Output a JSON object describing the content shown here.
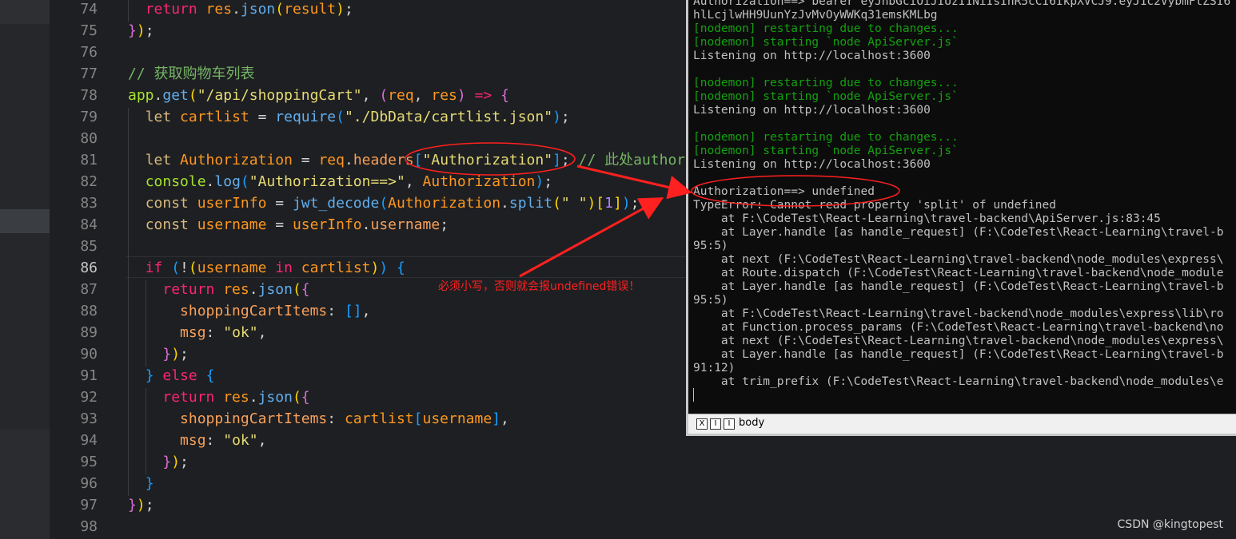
{
  "editor": {
    "line_numbers": [
      "74",
      "75",
      "76",
      "77",
      "78",
      "79",
      "80",
      "81",
      "82",
      "83",
      "84",
      "85",
      "86",
      "87",
      "88",
      "89",
      "90",
      "91",
      "92",
      "93",
      "94",
      "95",
      "96",
      "97",
      "98"
    ],
    "current_line": "86",
    "lines": [
      [
        [
          "plain",
          "  "
        ],
        [
          "kw",
          "return "
        ],
        [
          "var",
          "res"
        ],
        [
          "plain",
          "."
        ],
        [
          "meth",
          "json"
        ],
        [
          "br1",
          "("
        ],
        [
          "var",
          "result"
        ],
        [
          "br1",
          ")"
        ],
        [
          "plain",
          ";"
        ]
      ],
      [
        [
          "br2",
          "}"
        ],
        [
          "br1",
          ")"
        ],
        [
          "plain",
          ";"
        ]
      ],
      [],
      [
        [
          "cm",
          "// 获取购物车列表"
        ]
      ],
      [
        [
          "fn",
          "app"
        ],
        [
          "plain",
          "."
        ],
        [
          "meth",
          "get"
        ],
        [
          "br1",
          "("
        ],
        [
          "str",
          "\"/api/shoppingCart\""
        ],
        [
          "plain",
          ", "
        ],
        [
          "br2",
          "("
        ],
        [
          "var",
          "req"
        ],
        [
          "plain",
          ", "
        ],
        [
          "var",
          "res"
        ],
        [
          "br2",
          ")"
        ],
        [
          "plain",
          " "
        ],
        [
          "kw",
          "=>"
        ],
        [
          "plain",
          " "
        ],
        [
          "br2",
          "{"
        ]
      ],
      [
        [
          "plain",
          "  "
        ],
        [
          "kw2",
          "let "
        ],
        [
          "var",
          "cartlist"
        ],
        [
          "plain",
          " = "
        ],
        [
          "meth",
          "require"
        ],
        [
          "br3",
          "("
        ],
        [
          "str",
          "\"./DbData/cartlist.json\""
        ],
        [
          "br3",
          ")"
        ],
        [
          "plain",
          ";"
        ]
      ],
      [],
      [
        [
          "plain",
          "  "
        ],
        [
          "kw2",
          "let "
        ],
        [
          "var",
          "Authorization"
        ],
        [
          "plain",
          " = "
        ],
        [
          "var",
          "req"
        ],
        [
          "plain",
          "."
        ],
        [
          "prop",
          "headers"
        ],
        [
          "br3",
          "["
        ],
        [
          "str",
          "\"Authorization\""
        ],
        [
          "br3",
          "]"
        ],
        [
          "plain",
          "; "
        ],
        [
          "cm",
          "// 此处author"
        ]
      ],
      [
        [
          "plain",
          "  "
        ],
        [
          "fn",
          "console"
        ],
        [
          "plain",
          "."
        ],
        [
          "meth",
          "log"
        ],
        [
          "br3",
          "("
        ],
        [
          "str",
          "\"Authorization==>\""
        ],
        [
          "plain",
          ", "
        ],
        [
          "var",
          "Authorization"
        ],
        [
          "br3",
          ")"
        ],
        [
          "plain",
          ";"
        ]
      ],
      [
        [
          "plain",
          "  "
        ],
        [
          "kw2",
          "const "
        ],
        [
          "var",
          "userInfo"
        ],
        [
          "plain",
          " = "
        ],
        [
          "meth",
          "jwt_decode"
        ],
        [
          "br3",
          "("
        ],
        [
          "var",
          "Authorization"
        ],
        [
          "plain",
          "."
        ],
        [
          "meth",
          "split"
        ],
        [
          "br1",
          "("
        ],
        [
          "str",
          "\" \""
        ],
        [
          "br1",
          ")"
        ],
        [
          "br1",
          "["
        ],
        [
          "num",
          "1"
        ],
        [
          "br1",
          "]"
        ],
        [
          "br3",
          ")"
        ],
        [
          "plain",
          ";"
        ]
      ],
      [
        [
          "plain",
          "  "
        ],
        [
          "kw2",
          "const "
        ],
        [
          "var",
          "username"
        ],
        [
          "plain",
          " = "
        ],
        [
          "var",
          "userInfo"
        ],
        [
          "plain",
          "."
        ],
        [
          "prop",
          "username"
        ],
        [
          "plain",
          ";"
        ]
      ],
      [],
      [
        [
          "plain",
          "  "
        ],
        [
          "kw",
          "if "
        ],
        [
          "br3",
          "("
        ],
        [
          "plain",
          "!"
        ],
        [
          "br1",
          "("
        ],
        [
          "var",
          "username"
        ],
        [
          "kw",
          " in "
        ],
        [
          "var",
          "cartlist"
        ],
        [
          "br1",
          ")"
        ],
        [
          "br3",
          ")"
        ],
        [
          "plain",
          " "
        ],
        [
          "br3",
          "{"
        ]
      ],
      [
        [
          "plain",
          "    "
        ],
        [
          "kw",
          "return "
        ],
        [
          "var",
          "res"
        ],
        [
          "plain",
          "."
        ],
        [
          "meth",
          "json"
        ],
        [
          "br1",
          "("
        ],
        [
          "br2",
          "{"
        ]
      ],
      [
        [
          "plain",
          "      "
        ],
        [
          "prop",
          "shoppingCartItems"
        ],
        [
          "plain",
          ": "
        ],
        [
          "br3",
          "["
        ],
        [
          "br3",
          "]"
        ],
        [
          "plain",
          ","
        ]
      ],
      [
        [
          "plain",
          "      "
        ],
        [
          "prop",
          "msg"
        ],
        [
          "plain",
          ": "
        ],
        [
          "str",
          "\"ok\""
        ],
        [
          "plain",
          ","
        ]
      ],
      [
        [
          "plain",
          "    "
        ],
        [
          "br2",
          "}"
        ],
        [
          "br1",
          ")"
        ],
        [
          "plain",
          ";"
        ]
      ],
      [
        [
          "plain",
          "  "
        ],
        [
          "br3",
          "}"
        ],
        [
          "kw",
          " else "
        ],
        [
          "br3",
          "{"
        ]
      ],
      [
        [
          "plain",
          "    "
        ],
        [
          "kw",
          "return "
        ],
        [
          "var",
          "res"
        ],
        [
          "plain",
          "."
        ],
        [
          "meth",
          "json"
        ],
        [
          "br1",
          "("
        ],
        [
          "br2",
          "{"
        ]
      ],
      [
        [
          "plain",
          "      "
        ],
        [
          "prop",
          "shoppingCartItems"
        ],
        [
          "plain",
          ": "
        ],
        [
          "var",
          "cartlist"
        ],
        [
          "br3",
          "["
        ],
        [
          "var",
          "username"
        ],
        [
          "br3",
          "]"
        ],
        [
          "plain",
          ","
        ]
      ],
      [
        [
          "plain",
          "      "
        ],
        [
          "prop",
          "msg"
        ],
        [
          "plain",
          ": "
        ],
        [
          "str",
          "\"ok\""
        ],
        [
          "plain",
          ","
        ]
      ],
      [
        [
          "plain",
          "    "
        ],
        [
          "br2",
          "}"
        ],
        [
          "br1",
          ")"
        ],
        [
          "plain",
          ";"
        ]
      ],
      [
        [
          "plain",
          "  "
        ],
        [
          "br3",
          "}"
        ]
      ],
      [
        [
          "br2",
          "}"
        ],
        [
          "br1",
          ")"
        ],
        [
          "plain",
          ";"
        ]
      ],
      []
    ]
  },
  "console": {
    "lines": [
      {
        "text": "Authorization==> bearer eyJhbGciOiJIUzI1NiIsInR5cCI6IkpXVCJ9.eyJ1c2VybmFtZSI6",
        "color": "white"
      },
      {
        "text": "hlLcjlwHH9UunYzJvMvOyWWKq31emsKMLbg",
        "color": "white"
      },
      {
        "text": "[nodemon] restarting due to changes...",
        "color": "green"
      },
      {
        "text": "[nodemon] starting `node ApiServer.js`",
        "color": "green"
      },
      {
        "text": "Listening on http://localhost:3600",
        "color": "white"
      },
      {
        "text": "",
        "color": "white"
      },
      {
        "text": "[nodemon] restarting due to changes...",
        "color": "green"
      },
      {
        "text": "[nodemon] starting `node ApiServer.js`",
        "color": "green"
      },
      {
        "text": "Listening on http://localhost:3600",
        "color": "white"
      },
      {
        "text": "",
        "color": "white"
      },
      {
        "text": "[nodemon] restarting due to changes...",
        "color": "green"
      },
      {
        "text": "[nodemon] starting `node ApiServer.js`",
        "color": "green"
      },
      {
        "text": "Listening on http://localhost:3600",
        "color": "white"
      },
      {
        "text": "",
        "color": "white"
      },
      {
        "text": "Authorization==> undefined",
        "color": "white"
      },
      {
        "text": "TypeError: Cannot read property 'split' of undefined",
        "color": "white"
      },
      {
        "text": "    at F:\\CodeTest\\React-Learning\\travel-backend\\ApiServer.js:83:45",
        "color": "white"
      },
      {
        "text": "    at Layer.handle [as handle_request] (F:\\CodeTest\\React-Learning\\travel-b",
        "color": "white"
      },
      {
        "text": "95:5)",
        "color": "white"
      },
      {
        "text": "    at next (F:\\CodeTest\\React-Learning\\travel-backend\\node_modules\\express\\",
        "color": "white"
      },
      {
        "text": "    at Route.dispatch (F:\\CodeTest\\React-Learning\\travel-backend\\node_module",
        "color": "white"
      },
      {
        "text": "    at Layer.handle [as handle_request] (F:\\CodeTest\\React-Learning\\travel-b",
        "color": "white"
      },
      {
        "text": "95:5)",
        "color": "white"
      },
      {
        "text": "    at F:\\CodeTest\\React-Learning\\travel-backend\\node_modules\\express\\lib\\ro",
        "color": "white"
      },
      {
        "text": "    at Function.process_params (F:\\CodeTest\\React-Learning\\travel-backend\\no",
        "color": "white"
      },
      {
        "text": "    at next (F:\\CodeTest\\React-Learning\\travel-backend\\node_modules\\express\\",
        "color": "white"
      },
      {
        "text": "    at Layer.handle [as handle_request] (F:\\CodeTest\\React-Learning\\travel-b",
        "color": "white"
      },
      {
        "text": "91:12)",
        "color": "white"
      },
      {
        "text": "    at trim_prefix (F:\\CodeTest\\React-Learning\\travel-backend\\node_modules\\e",
        "color": "white"
      }
    ],
    "status_text": "body",
    "status_buttons": [
      "X",
      "I",
      "I"
    ]
  },
  "annotation": {
    "text": "必须小写，否则就会报undefined错误！",
    "color": "#ff2020"
  },
  "watermark": "CSDN @kingtopest",
  "colors": {
    "editor_bg": "#1e1f22",
    "console_bg": "#0c0c0c",
    "console_green": "#13a10e",
    "annotation_red": "#ff2020"
  }
}
